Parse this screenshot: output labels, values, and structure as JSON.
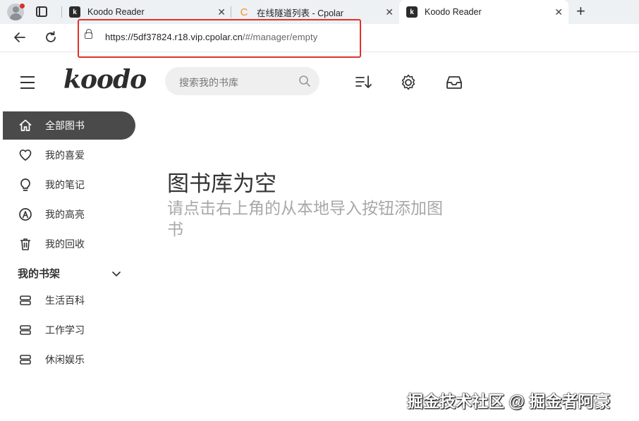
{
  "browser": {
    "tabs": [
      {
        "title": "Koodo Reader",
        "favicon": "koodo-icon",
        "active": false
      },
      {
        "title": "在线隧道列表 - Cpolar",
        "favicon": "cpolar-icon",
        "active": false
      },
      {
        "title": "Koodo Reader",
        "favicon": "koodo-icon",
        "active": true
      }
    ],
    "close_glyph": "✕",
    "new_tab_glyph": "+",
    "url_host": "https://5df37824.r18.vip.cpolar.cn",
    "url_path": "/#/manager/empty",
    "highlight_color": "#e0322a"
  },
  "app": {
    "logo": "koodo",
    "search_placeholder": "搜索我的书库",
    "sidebar": {
      "items": [
        {
          "label": "全部图书",
          "icon": "home-icon",
          "active": true
        },
        {
          "label": "我的喜爱",
          "icon": "heart-icon"
        },
        {
          "label": "我的笔记",
          "icon": "lightbulb-icon"
        },
        {
          "label": "我的高亮",
          "icon": "highlighter-icon"
        },
        {
          "label": "我的回收",
          "icon": "trash-icon"
        }
      ],
      "shelf_title": "我的书架",
      "shelves": [
        {
          "label": "生活百科",
          "icon": "shelf-icon"
        },
        {
          "label": "工作学习",
          "icon": "shelf-icon"
        },
        {
          "label": "休闲娱乐",
          "icon": "shelf-icon"
        }
      ]
    },
    "empty": {
      "title": "图书库为空",
      "subtitle": "请点击右上角的从本地导入按钮添加图书"
    },
    "active_color": "#4a4a4a"
  },
  "watermark": "掘金技术社区 @ 掘金者阿豪"
}
